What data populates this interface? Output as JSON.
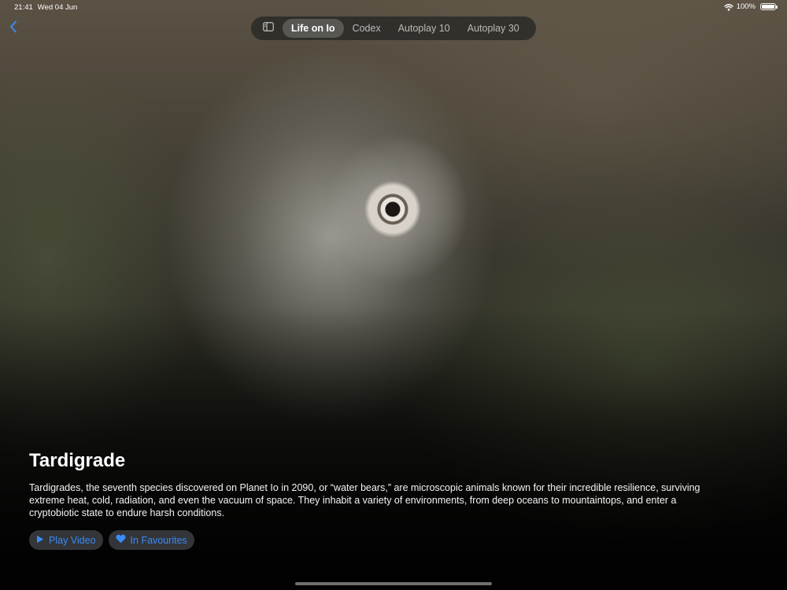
{
  "status_bar": {
    "time": "21:41",
    "date": "Wed 04 Jun",
    "battery_text": "100%",
    "battery_level": 1.0
  },
  "nav": {
    "back_icon": "chevron-left-icon",
    "sidebar_icon": "sidebar-icon",
    "tabs": [
      {
        "label": "Life on Io",
        "active": true
      },
      {
        "label": "Codex",
        "active": false
      },
      {
        "label": "Autoplay 10",
        "active": false
      },
      {
        "label": "Autoplay 30",
        "active": false
      }
    ]
  },
  "content": {
    "title": "Tardigrade",
    "description": "Tardigrades, the seventh species discovered on Planet Io in 2090, or “water bears,” are microscopic animals known for their incredible resilience, surviving extreme heat, cold, radiation, and even the vacuum of space. They inhabit a variety of environments, from deep oceans to mountaintops, and enter a cryptobiotic state to endure harsh conditions.",
    "play_button_label": "Play Video",
    "favourite_button_label": "In Favourites"
  },
  "colors": {
    "accent": "#3b8cf5",
    "pill_background": "#3c3e42"
  }
}
